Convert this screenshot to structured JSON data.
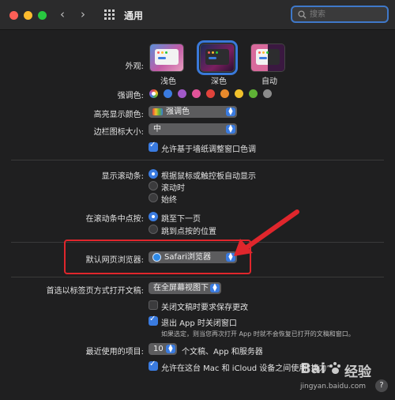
{
  "window": {
    "title": "通用"
  },
  "search": {
    "placeholder": "搜索"
  },
  "appearance": {
    "label": "外观:",
    "options": [
      "浅色",
      "深色",
      "自动"
    ],
    "selected": "深色"
  },
  "accent": {
    "label": "强调色:",
    "colors": [
      "#a97bd6",
      "#3a7be0",
      "#a259c9",
      "#e2539a",
      "#e0433b",
      "#e88a2c",
      "#f1c12c",
      "#5fb336",
      "#8c8c8c"
    ],
    "selected_index": 0
  },
  "highlight": {
    "label": "高亮显示颜色:",
    "value": "强调色"
  },
  "sidebar_icon": {
    "label": "边栏图标大小:",
    "value": "中"
  },
  "wallpaper_tint": {
    "label": "允许基于墙纸调整窗口色调",
    "checked": true
  },
  "scroll_bars": {
    "label": "显示滚动条:",
    "options": [
      "根据鼠标或触控板自动显示",
      "滚动时",
      "始终"
    ],
    "selected_index": 0
  },
  "click_scroll": {
    "label": "在滚动条中点按:",
    "options": [
      "跳至下一页",
      "跳到点按的位置"
    ],
    "selected_index": 0
  },
  "browser": {
    "label": "默认网页浏览器:",
    "value": "Safari浏览器"
  },
  "tabs_pref": {
    "label": "首选以标签页方式打开文稿:",
    "value": "在全屏幕视图下"
  },
  "ask_save": {
    "label": "关闭文稿时要求保存更改",
    "checked": false
  },
  "close_windows": {
    "label": "退出 App 时关闭窗口",
    "checked": true,
    "note": "如果选定，则当您再次打开 App 时就不会恢复已打开的文稿和窗口。"
  },
  "recent": {
    "label": "最近使用的项目:",
    "value": "10",
    "suffix": "个文稿、App 和服务器"
  },
  "handoff": {
    "label": "允许在这台 Mac 和 iCloud 设备之间使用“接力”",
    "checked": true
  },
  "watermark": {
    "brand": "Bai",
    "brand2": "经验",
    "url": "jingyan.baidu.com"
  }
}
